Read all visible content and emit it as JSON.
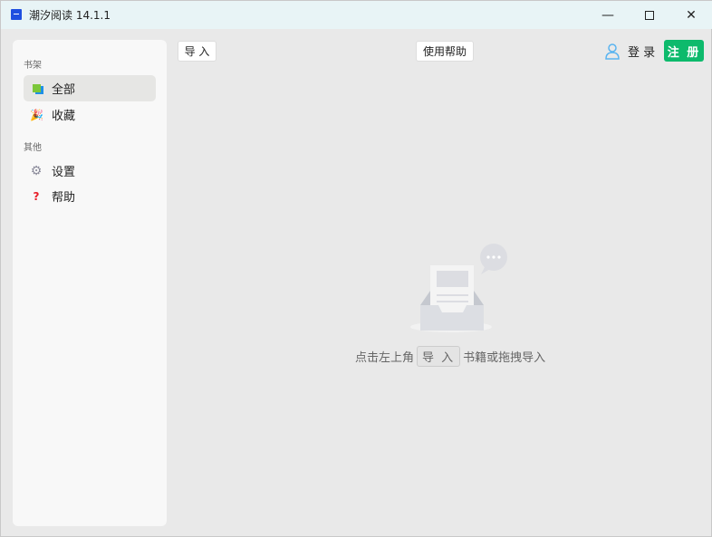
{
  "window": {
    "title": "潮汐阅读 14.1.1"
  },
  "sidebar": {
    "section_shelf": "书架",
    "section_other": "其他",
    "items": [
      {
        "label": "全部"
      },
      {
        "label": "收藏"
      },
      {
        "label": "设置"
      },
      {
        "label": "帮助"
      }
    ]
  },
  "toolbar": {
    "import": "导 入",
    "help": "使用帮助",
    "login": "登 录",
    "register": "注 册"
  },
  "empty": {
    "before": "点击左上角",
    "key": "导 入",
    "after": "书籍或拖拽导入"
  },
  "colors": {
    "accent": "#0dba6c"
  }
}
